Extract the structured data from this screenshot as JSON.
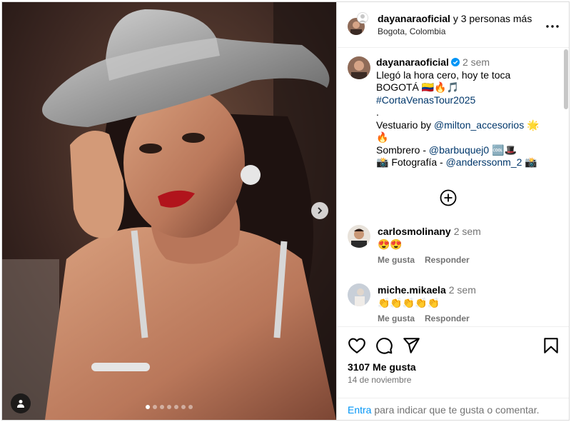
{
  "header": {
    "username": "dayanaraoficial",
    "collab_text": " y 3 personas más",
    "location": "Bogota, Colombia"
  },
  "caption": {
    "username": "dayanaraoficial",
    "time": "2 sem",
    "line1": "Llegó la hora cero, hoy te toca",
    "line2": "BOGOTÁ 🇨🇴🔥🎵",
    "hashtag": "#CortaVenasTour2025",
    "dot": ".",
    "vestuario_label": "Vestuario by ",
    "vestuario_handle": "@milton_accesorios",
    "vestuario_emoji": " 🌟",
    "fire": "🔥",
    "sombrero_label": "Sombrero - ",
    "sombrero_handle": "@barbuquej0",
    "sombrero_emoji": " 🆒🎩",
    "foto_label": "📸 Fotografía - ",
    "foto_handle": "@anderssonm_2",
    "foto_emoji": " 📸"
  },
  "comments": [
    {
      "username": "carlosmolinany",
      "time": "2 sem",
      "text": "😍😍",
      "like": "Me gusta",
      "reply": "Responder"
    },
    {
      "username": "miche.mikaela",
      "time": "2 sem",
      "text": "👏👏👏👏👏",
      "like": "Me gusta",
      "reply": "Responder"
    }
  ],
  "footer": {
    "likes": "3107 Me gusta",
    "date": "14 de noviembre",
    "login_link": "Entra",
    "login_text": " para indicar que te gusta o comentar."
  },
  "carousel": {
    "slides": 7,
    "current": 1
  },
  "icons": {
    "next": "chevron-right-icon",
    "tag": "user-tag-icon",
    "more": "more-horizontal-icon",
    "load_more": "plus-circle-icon",
    "like": "heart-icon",
    "comment": "comment-icon",
    "share": "send-icon",
    "save": "bookmark-icon"
  },
  "colors": {
    "link": "#00376b",
    "accent": "#0095f6",
    "muted": "#737373"
  }
}
